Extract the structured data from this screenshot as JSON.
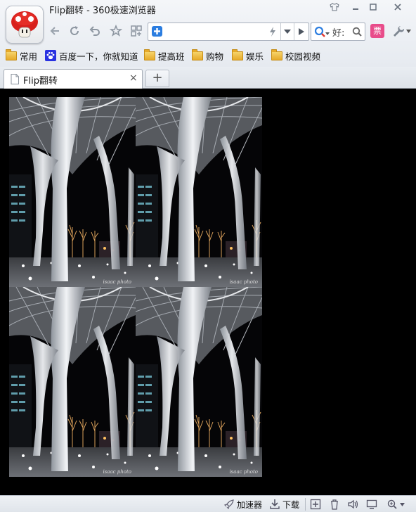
{
  "window": {
    "title": "Flip翻转 - 360极速浏览器"
  },
  "address_bar": {
    "value": ""
  },
  "search_box": {
    "value": "好:"
  },
  "toolbar": {
    "ticket_label": "票"
  },
  "bookmarks": [
    {
      "label": "常用",
      "icon": "folder-icon"
    },
    {
      "label": "百度一下，你就知道",
      "icon": "baidu-paw-icon"
    },
    {
      "label": "提高班",
      "icon": "folder-icon"
    },
    {
      "label": "购物",
      "icon": "folder-icon"
    },
    {
      "label": "娱乐",
      "icon": "folder-icon"
    },
    {
      "label": "校园视频",
      "icon": "folder-icon"
    }
  ],
  "tabs": [
    {
      "label": "Flip翻转",
      "close": "×",
      "active": true
    }
  ],
  "new_tab_label": "+",
  "images": [
    {
      "caption": "isaac photo"
    },
    {
      "caption": "isaac photo"
    },
    {
      "caption": "isaac photo"
    },
    {
      "caption": "isaac photo"
    }
  ],
  "status_bar": {
    "accelerator_label": "加速器",
    "download_label": "下载"
  },
  "colors": {
    "page_background": "#000000",
    "chrome_background": "#e9edf2",
    "accent_blue": "#2b7de0",
    "ticket_pink": "#e84c8a"
  }
}
